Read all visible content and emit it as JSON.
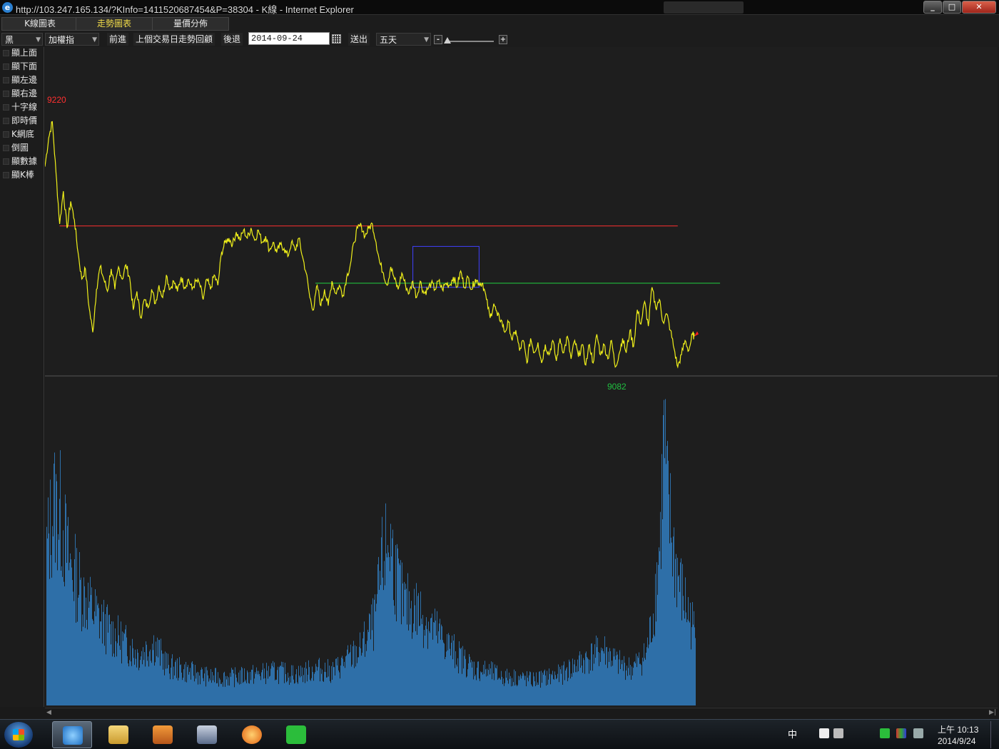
{
  "window": {
    "title": "http://103.247.165.134/?KInfo=1411520687454&P=38304 - K線 - Internet Explorer"
  },
  "tabs": [
    {
      "label": "K線圖表",
      "active": false
    },
    {
      "label": "走勢圖表",
      "active": true
    },
    {
      "label": "量價分佈",
      "active": false
    }
  ],
  "toolbar": {
    "color_select": "黑",
    "index_select": "加權指",
    "prev_label": "前進",
    "review_label": "上個交易日走勢回顧",
    "back_label": "後退",
    "date_value": "2014-09-24",
    "submit_label": "送出",
    "range_select": "五天",
    "minus_label": "-",
    "plus_label": "+",
    "zoom_level": 0.05
  },
  "sidebar": {
    "items": [
      {
        "label": "顯上面"
      },
      {
        "label": "顯下面"
      },
      {
        "label": "顯左邊"
      },
      {
        "label": "顯右邊"
      },
      {
        "label": "十字線"
      },
      {
        "label": "即時價"
      },
      {
        "label": "K網底"
      },
      {
        "label": "倒圖"
      },
      {
        "label": "顯數據"
      },
      {
        "label": "顯K棒"
      }
    ]
  },
  "chart_data": [
    {
      "type": "line",
      "title": "",
      "annotation_high": "9220",
      "annotation_low": "9082",
      "ylim": [
        9076,
        9226
      ],
      "x_count": 1250,
      "series": [
        {
          "color": "#f0f01a",
          "points": [
            [
              0,
              9178
            ],
            [
              10,
              9192
            ],
            [
              20,
              9200
            ],
            [
              30,
              9175
            ],
            [
              40,
              9150
            ],
            [
              50,
              9166
            ],
            [
              60,
              9148
            ],
            [
              70,
              9161
            ],
            [
              80,
              9152
            ],
            [
              90,
              9136
            ],
            [
              100,
              9123
            ],
            [
              110,
              9128
            ],
            [
              120,
              9109
            ],
            [
              130,
              9097
            ],
            [
              140,
              9118
            ],
            [
              150,
              9129
            ],
            [
              160,
              9123
            ],
            [
              170,
              9117
            ],
            [
              180,
              9128
            ],
            [
              190,
              9118
            ],
            [
              200,
              9129
            ],
            [
              210,
              9123
            ],
            [
              220,
              9130
            ],
            [
              230,
              9124
            ],
            [
              240,
              9108
            ],
            [
              250,
              9117
            ],
            [
              260,
              9104
            ],
            [
              270,
              9113
            ],
            [
              280,
              9109
            ],
            [
              290,
              9118
            ],
            [
              300,
              9111
            ],
            [
              310,
              9120
            ],
            [
              320,
              9114
            ],
            [
              330,
              9125
            ],
            [
              340,
              9118
            ],
            [
              350,
              9122
            ],
            [
              360,
              9117
            ],
            [
              370,
              9124
            ],
            [
              380,
              9119
            ],
            [
              390,
              9123
            ],
            [
              400,
              9118
            ],
            [
              410,
              9122
            ],
            [
              420,
              9121
            ],
            [
              430,
              9113
            ],
            [
              440,
              9123
            ],
            [
              450,
              9118
            ],
            [
              460,
              9125
            ],
            [
              470,
              9120
            ],
            [
              480,
              9136
            ],
            [
              490,
              9141
            ],
            [
              500,
              9143
            ],
            [
              510,
              9140
            ],
            [
              520,
              9146
            ],
            [
              530,
              9142
            ],
            [
              540,
              9147
            ],
            [
              550,
              9143
            ],
            [
              560,
              9148
            ],
            [
              570,
              9142
            ],
            [
              580,
              9147
            ],
            [
              590,
              9141
            ],
            [
              600,
              9144
            ],
            [
              610,
              9137
            ],
            [
              620,
              9141
            ],
            [
              630,
              9136
            ],
            [
              640,
              9140
            ],
            [
              650,
              9138
            ],
            [
              660,
              9134
            ],
            [
              670,
              9141
            ],
            [
              680,
              9137
            ],
            [
              690,
              9143
            ],
            [
              700,
              9134
            ],
            [
              710,
              9126
            ],
            [
              720,
              9114
            ],
            [
              730,
              9108
            ],
            [
              740,
              9120
            ],
            [
              750,
              9110
            ],
            [
              760,
              9118
            ],
            [
              770,
              9110
            ],
            [
              780,
              9122
            ],
            [
              790,
              9116
            ],
            [
              800,
              9120
            ],
            [
              810,
              9115
            ],
            [
              820,
              9124
            ],
            [
              830,
              9130
            ],
            [
              840,
              9141
            ],
            [
              850,
              9148
            ],
            [
              860,
              9149
            ],
            [
              870,
              9144
            ],
            [
              880,
              9148
            ],
            [
              890,
              9150
            ],
            [
              900,
              9141
            ],
            [
              910,
              9131
            ],
            [
              920,
              9126
            ],
            [
              930,
              9120
            ],
            [
              940,
              9129
            ],
            [
              950,
              9123
            ],
            [
              960,
              9118
            ],
            [
              970,
              9126
            ],
            [
              980,
              9120
            ],
            [
              990,
              9116
            ],
            [
              1000,
              9122
            ],
            [
              1010,
              9114
            ],
            [
              1020,
              9122
            ],
            [
              1030,
              9116
            ],
            [
              1040,
              9118
            ],
            [
              1050,
              9121
            ],
            [
              1060,
              9118
            ],
            [
              1070,
              9122
            ],
            [
              1080,
              9118
            ],
            [
              1090,
              9121
            ],
            [
              1100,
              9120
            ],
            [
              1110,
              9124
            ],
            [
              1120,
              9119
            ],
            [
              1130,
              9127
            ],
            [
              1140,
              9119
            ],
            [
              1150,
              9124
            ],
            [
              1160,
              9118
            ],
            [
              1170,
              9123
            ],
            [
              1180,
              9121
            ],
            [
              1190,
              9121
            ],
            [
              1200,
              9113
            ],
            [
              1210,
              9104
            ],
            [
              1220,
              9111
            ],
            [
              1230,
              9105
            ],
            [
              1240,
              9103
            ],
            [
              1250,
              9097
            ],
            [
              1260,
              9102
            ],
            [
              1270,
              9093
            ],
            [
              1280,
              9098
            ],
            [
              1290,
              9088
            ],
            [
              1300,
              9093
            ],
            [
              1310,
              9082
            ],
            [
              1320,
              9094
            ],
            [
              1330,
              9087
            ],
            [
              1340,
              9092
            ],
            [
              1350,
              9082
            ],
            [
              1360,
              9091
            ],
            [
              1370,
              9086
            ],
            [
              1380,
              9093
            ],
            [
              1390,
              9083
            ],
            [
              1400,
              9094
            ],
            [
              1410,
              9087
            ],
            [
              1420,
              9095
            ],
            [
              1430,
              9084
            ],
            [
              1440,
              9093
            ],
            [
              1450,
              9085
            ],
            [
              1460,
              9091
            ],
            [
              1470,
              9081
            ],
            [
              1480,
              9091
            ],
            [
              1490,
              9082
            ],
            [
              1500,
              9096
            ],
            [
              1510,
              9086
            ],
            [
              1520,
              9091
            ],
            [
              1530,
              9084
            ],
            [
              1540,
              9093
            ],
            [
              1550,
              9080
            ],
            [
              1560,
              9086
            ],
            [
              1570,
              9094
            ],
            [
              1580,
              9087
            ],
            [
              1590,
              9098
            ],
            [
              1600,
              9090
            ],
            [
              1610,
              9108
            ],
            [
              1620,
              9101
            ],
            [
              1630,
              9112
            ],
            [
              1640,
              9100
            ],
            [
              1650,
              9119
            ],
            [
              1660,
              9109
            ],
            [
              1670,
              9113
            ],
            [
              1680,
              9102
            ],
            [
              1690,
              9106
            ],
            [
              1700,
              9098
            ],
            [
              1710,
              9089
            ],
            [
              1720,
              9080
            ],
            [
              1730,
              9086
            ],
            [
              1740,
              9093
            ],
            [
              1750,
              9088
            ],
            [
              1760,
              9096
            ],
            [
              1765,
              9095
            ]
          ]
        }
      ],
      "ref_lines": [
        {
          "name": "red-level",
          "value": 9149,
          "from": 40,
          "to": 1720,
          "color": "#ff3030"
        },
        {
          "name": "green-level",
          "value": 9121,
          "from": 735,
          "to": 1835,
          "color": "#20d040"
        }
      ],
      "box": {
        "x_from": 1000,
        "x_to": 1180,
        "y_from": 9139,
        "y_to": 9119,
        "color": "#4040ff"
      }
    },
    {
      "type": "bar",
      "title": "",
      "color": "#2e6fa8",
      "ylim": [
        0,
        1.0
      ],
      "bar_count": 910,
      "envelope": [
        [
          0,
          0.55
        ],
        [
          10,
          0.72
        ],
        [
          20,
          0.68
        ],
        [
          30,
          0.52
        ],
        [
          50,
          0.4
        ],
        [
          70,
          0.32
        ],
        [
          90,
          0.26
        ],
        [
          110,
          0.22
        ],
        [
          130,
          0.18
        ],
        [
          150,
          0.22
        ],
        [
          170,
          0.14
        ],
        [
          200,
          0.12
        ],
        [
          230,
          0.1
        ],
        [
          260,
          0.1
        ],
        [
          290,
          0.11
        ],
        [
          320,
          0.12
        ],
        [
          350,
          0.11
        ],
        [
          380,
          0.13
        ],
        [
          400,
          0.12
        ],
        [
          420,
          0.16
        ],
        [
          440,
          0.2
        ],
        [
          460,
          0.3
        ],
        [
          470,
          0.5
        ],
        [
          480,
          0.6
        ],
        [
          490,
          0.46
        ],
        [
          500,
          0.36
        ],
        [
          520,
          0.34
        ],
        [
          540,
          0.28
        ],
        [
          560,
          0.22
        ],
        [
          580,
          0.17
        ],
        [
          600,
          0.13
        ],
        [
          620,
          0.12
        ],
        [
          640,
          0.1
        ],
        [
          660,
          0.1
        ],
        [
          680,
          0.09
        ],
        [
          700,
          0.1
        ],
        [
          720,
          0.11
        ],
        [
          740,
          0.14
        ],
        [
          760,
          0.17
        ],
        [
          780,
          0.2
        ],
        [
          800,
          0.15
        ],
        [
          820,
          0.13
        ],
        [
          840,
          0.18
        ],
        [
          850,
          0.32
        ],
        [
          860,
          0.6
        ],
        [
          865,
          0.95
        ],
        [
          870,
          0.72
        ],
        [
          880,
          0.52
        ],
        [
          890,
          0.4
        ],
        [
          900,
          0.32
        ],
        [
          910,
          0.25
        ]
      ]
    }
  ]
}
